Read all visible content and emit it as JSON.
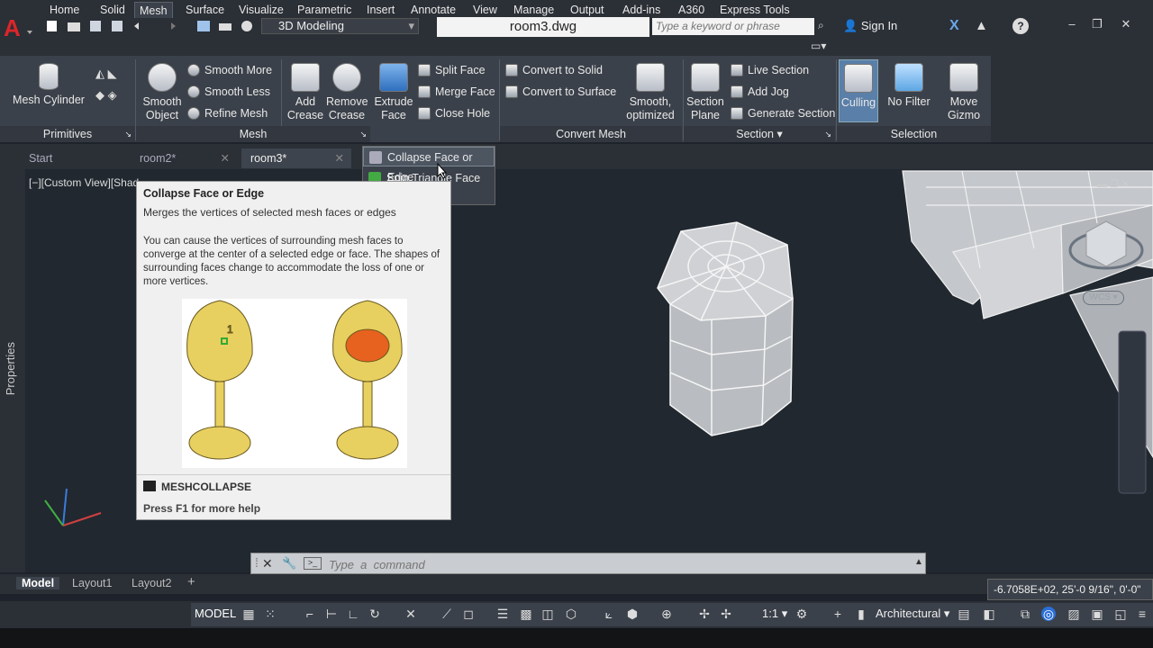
{
  "titlebar": {
    "workspace": "3D Modeling",
    "filename": "room3.dwg",
    "search_placeholder": "Type a keyword or phrase",
    "signin": "Sign In"
  },
  "tabs": [
    "Home",
    "Solid",
    "Mesh",
    "Surface",
    "Visualize",
    "Parametric",
    "Insert",
    "Annotate",
    "View",
    "Manage",
    "Output",
    "Add-ins",
    "A360",
    "Express Tools"
  ],
  "ribbon": {
    "mesh_cylinder": "Mesh Cylinder",
    "smooth_object": [
      "Smooth",
      "Object"
    ],
    "smooth_more": "Smooth More",
    "smooth_less": "Smooth Less",
    "refine_mesh": "Refine Mesh",
    "add_crease": [
      "Add",
      "Crease"
    ],
    "remove_crease": [
      "Remove",
      "Crease"
    ],
    "extrude_face": [
      "Extrude",
      "Face"
    ],
    "split_face": "Split Face",
    "merge_face": "Merge Face",
    "close_hole": "Close Hole",
    "convert_solid": "Convert to Solid",
    "convert_surface": "Convert to Surface",
    "smooth_optimized": [
      "Smooth,",
      "optimized"
    ],
    "section_plane": [
      "Section",
      "Plane"
    ],
    "live_section": "Live Section",
    "add_jog": "Add Jog",
    "generate_section": "Generate Section",
    "culling": "Culling",
    "no_filter": "No Filter",
    "move_gizmo": [
      "Move",
      "Gizmo"
    ],
    "panels": [
      "Primitives",
      "Mesh",
      "Convert Mesh",
      "Section",
      "Selection"
    ]
  },
  "doctabs": [
    "Start",
    "room2*",
    "room3*"
  ],
  "dropdown": [
    "Collapse Face or Edge",
    "Spin Triangle Face"
  ],
  "viewport": {
    "label": "[−][Custom View][Shad",
    "properties": "Properties",
    "wcs": "WCS"
  },
  "tooltip": {
    "title": "Collapse Face or Edge",
    "summary": "Merges the vertices of selected mesh faces or edges",
    "body": "You can cause the vertices of surrounding mesh faces to converge at the center of a selected edge or face. The shapes of surrounding faces change to accommodate the loss of one or more vertices.",
    "command": "MESHCOLLAPSE",
    "help": "Press F1 for more help"
  },
  "cmdline": {
    "placeholder": "Type  a  command"
  },
  "layouts": [
    "Model",
    "Layout1",
    "Layout2"
  ],
  "status": {
    "coords": "-6.7058E+02, 25'-0 9/16\", 0'-0\"",
    "model": "MODEL",
    "scale": "1:1",
    "units": "Architectural"
  }
}
